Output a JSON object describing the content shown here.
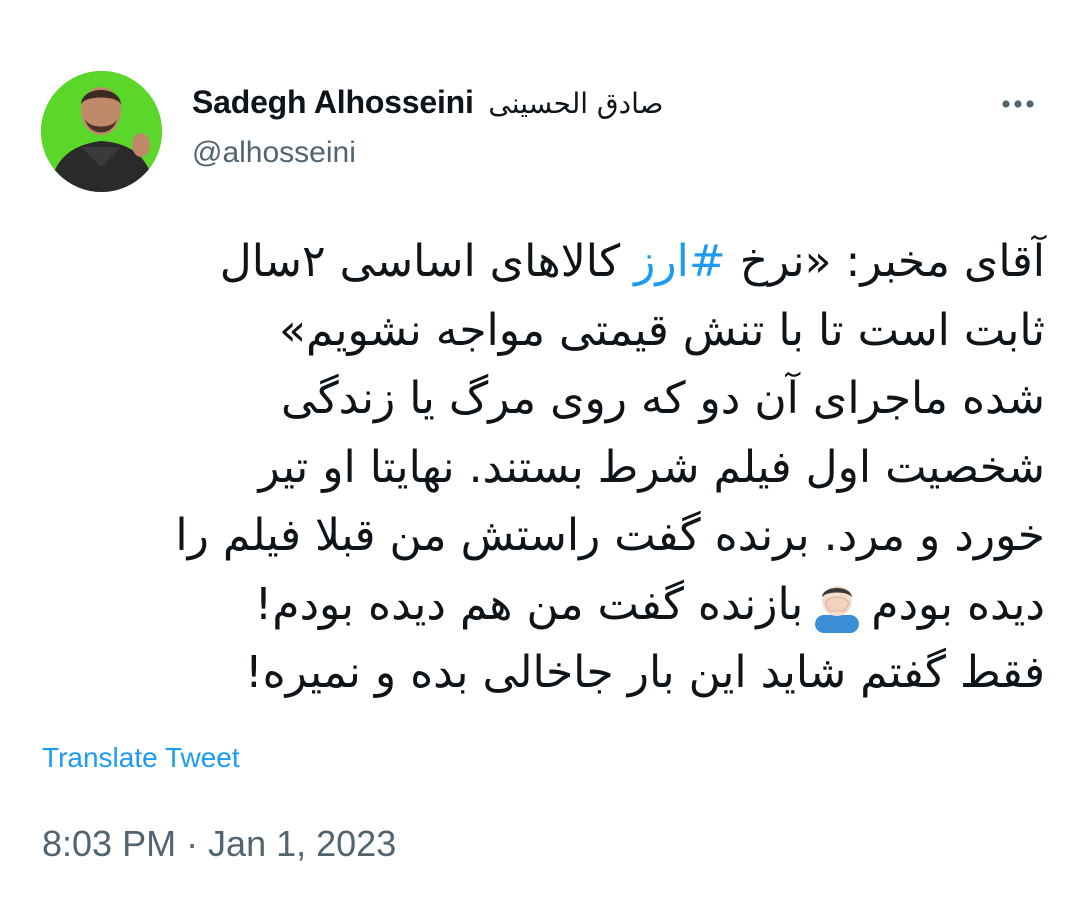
{
  "author": {
    "display_name": "Sadegh Alhosseini",
    "display_name_arabic": "صادق الحسینی",
    "handle": "@alhosseini",
    "avatar_icon": "profile-photo",
    "avatar_bg": "#5bd62a"
  },
  "menu": {
    "icon": "more-icon"
  },
  "tweet": {
    "line1_pre": "آقای مخبر: «نرخ ",
    "hashtag": "#ارز",
    "line1_post": " کالاهای اساسی ۲سال",
    "line2": "ثابت است تا با تنش قیمتی مواجه نشویم»",
    "line3": "شده ماجرای آن دو که روی مرگ یا زندگی",
    "line4": "شخصیت اول فیلم شرط بستند. نهایتا او تیر",
    "line5": "خورد و مرد. برنده گفت راستش من قبلا فیلم را",
    "line6_pre": "دیده بودم",
    "emoji_icon": "facepalm-emoji",
    "line6_post": "بازنده گفت من هم دیده بودم!",
    "line7": "فقط گفتم شاید این بار جاخالی بده و نمیره!"
  },
  "translate_label": "Translate Tweet",
  "timestamp": "8:03 PM · Jan 1, 2023",
  "colors": {
    "link": "#1d9bf0",
    "secondary_text": "#536471",
    "primary_text": "#0f1419"
  }
}
